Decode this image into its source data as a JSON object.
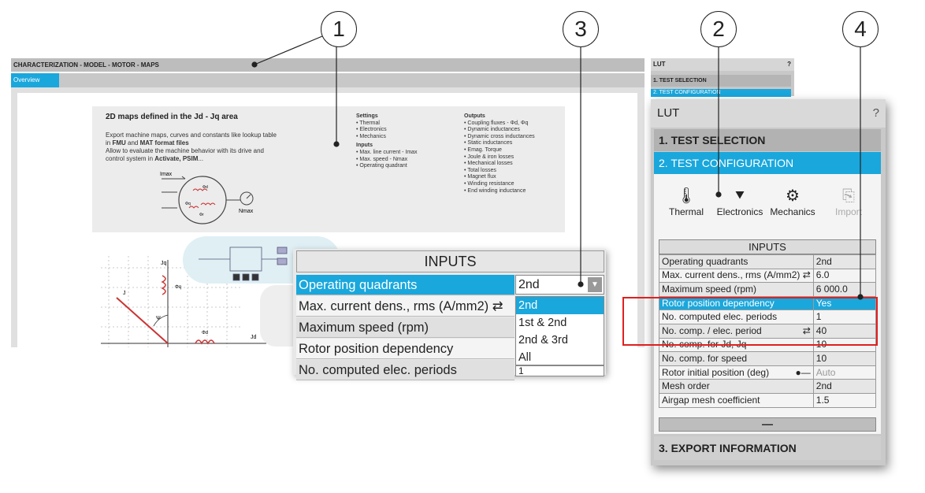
{
  "callouts": [
    "1",
    "2",
    "3",
    "4"
  ],
  "main_window": {
    "title": "CHARACTERIZATION - MODEL - MOTOR - MAPS",
    "tab_overview": "Overview",
    "info": {
      "heading": "2D maps defined in the Jd - Jq area",
      "line1": "Export machine maps, curves and constants like lookup table",
      "line2a": "in ",
      "fmu": "FMU",
      "line2b": " and ",
      "mat": "MAT format files",
      "line3": "Allow to evaluate the machine behavior with its drive and",
      "line4a": "control system in ",
      "activate": "Activate, PSIM",
      "line4b": "...",
      "settings_title": "Settings",
      "settings": [
        "Thermal",
        "Electronics",
        "Mechanics"
      ],
      "inputs_title": "Inputs",
      "inputs": [
        "Max. line current - Imax",
        "Max. speed - Nmax",
        "Operating quadrant"
      ],
      "outputs_title": "Outputs",
      "outputs": [
        "Coupling fluxes - Φd, Φq",
        "Dynamic inductances",
        "Dynamic cross inductances",
        "Static inductances",
        "Emag. Torque",
        "Joule & iron losses",
        "Mechanical losses",
        "Total losses",
        "Magnet flux",
        "Winding resistance",
        "End winding inductance"
      ],
      "diagram_labels": {
        "imax": "Imax",
        "nmax": "Nmax",
        "phi_d": "Φd",
        "phi_q": "Φq",
        "phi_r": "Φr"
      }
    },
    "diagram_labels": {
      "jd": "Jd",
      "jq": "Jq",
      "psi": "Ψ",
      "j": "J",
      "phi_d": "Φd",
      "phi_q": "Φq"
    }
  },
  "lut_small": {
    "title": "LUT",
    "help": "?",
    "section1": "1. TEST SELECTION",
    "section2": "2. TEST CONFIGURATION"
  },
  "lut": {
    "title": "LUT",
    "help": "?",
    "section1": "1. TEST SELECTION",
    "section2": "2. TEST CONFIGURATION",
    "section3": "3. EXPORT INFORMATION",
    "tools": [
      {
        "label": "Thermal",
        "icon": "thermometer-icon"
      },
      {
        "label": "Electronics",
        "icon": "diode-icon"
      },
      {
        "label": "Mechanics",
        "icon": "gears-icon"
      },
      {
        "label": "Import",
        "icon": "import-icon"
      }
    ],
    "inputs_header": "INPUTS",
    "rows": [
      {
        "label": "Operating quadrants",
        "value": "2nd"
      },
      {
        "label": "Max. current dens., rms (A/mm2)",
        "value": "6.0"
      },
      {
        "label": "Maximum speed (rpm)",
        "value": "6 000.0"
      },
      {
        "label": "Rotor position dependency",
        "value": "Yes"
      },
      {
        "label": "No. computed elec. periods",
        "value": "1"
      },
      {
        "label": "No. comp. / elec. period",
        "value": "40"
      },
      {
        "label": "No. comp. for Jd, Jq",
        "value": "10"
      },
      {
        "label": "No. comp. for speed",
        "value": "10"
      },
      {
        "label": "Rotor initial position (deg)",
        "value": "Auto"
      },
      {
        "label": "Mesh order",
        "value": "2nd"
      },
      {
        "label": "Airgap mesh coefficient",
        "value": "1.5"
      }
    ],
    "collapse": "—"
  },
  "popup": {
    "header": "INPUTS",
    "rows": [
      "Operating quadrants",
      "Max. current dens., rms (A/mm2)",
      "Maximum speed (rpm)",
      "Rotor position dependency",
      "No. computed elec. periods"
    ],
    "select_value": "2nd",
    "options": [
      "2nd",
      "1st & 2nd",
      "2nd & 3rd",
      "All"
    ],
    "under_value": "1"
  },
  "colors": {
    "accent": "#1aa7dc",
    "highlight": "#e02020"
  }
}
